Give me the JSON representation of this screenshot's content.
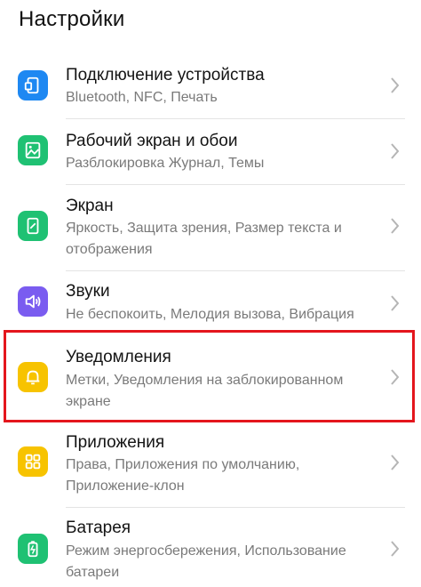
{
  "header": {
    "title": "Настройки"
  },
  "items": [
    {
      "title": "Подключение устройства",
      "subtitle": "Bluetooth, NFC, Печать",
      "icon": "device-connection-icon",
      "color": "#1e88f2"
    },
    {
      "title": "Рабочий экран и обои",
      "subtitle": "Разблокировка Журнал, Темы",
      "icon": "wallpaper-icon",
      "color": "#1fc173"
    },
    {
      "title": "Экран",
      "subtitle": "Яркость, Защита зрения, Размер текста и отображения",
      "icon": "display-icon",
      "color": "#1fc173"
    },
    {
      "title": "Звуки",
      "subtitle": "Не беспокоить, Мелодия вызова, Вибрация",
      "icon": "sound-icon",
      "color": "#7a5cf0"
    },
    {
      "title": "Уведомления",
      "subtitle": "Метки, Уведомления на заблокированном экране",
      "icon": "bell-icon",
      "color": "#f7c300"
    },
    {
      "title": "Приложения",
      "subtitle": "Права, Приложения по умолчанию, Приложение-клон",
      "icon": "apps-icon",
      "color": "#f7c300"
    },
    {
      "title": "Батарея",
      "subtitle": "Режим энергосбережения, Использование батареи",
      "icon": "battery-icon",
      "color": "#1fc173"
    }
  ],
  "highlight_color": "#e4161d"
}
